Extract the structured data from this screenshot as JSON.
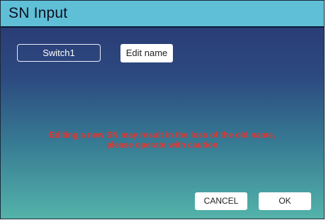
{
  "dialog": {
    "title": "SN Input",
    "name_value": "Switch1",
    "edit_label": "Edit name",
    "warning": "Editing a new SN may result in the loss of the old name, please operate with caution",
    "cancel_label": "CANCEL",
    "ok_label": "OK"
  },
  "colors": {
    "title_bar": "#5fbfd7",
    "warning_text": "#e8342c",
    "gradient_top": "#2a3570",
    "gradient_bottom": "#53b3aa"
  }
}
